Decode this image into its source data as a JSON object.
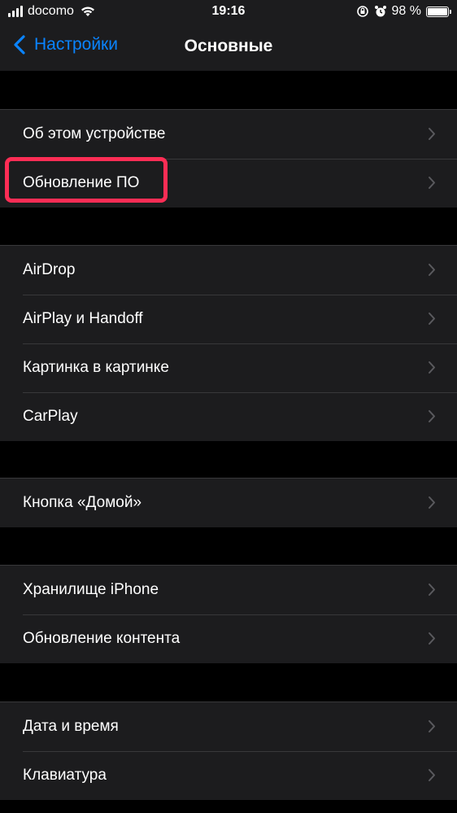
{
  "status": {
    "carrier": "docomo",
    "time": "19:16",
    "battery": "98 %",
    "battery_level": 0.98
  },
  "nav": {
    "back_label": "Настройки",
    "title": "Основные"
  },
  "groups": [
    [
      "Об этом устройстве",
      "Обновление ПО"
    ],
    [
      "AirDrop",
      "AirPlay и Handoff",
      "Картинка в картинке",
      "CarPlay"
    ],
    [
      "Кнопка «Домой»"
    ],
    [
      "Хранилище iPhone",
      "Обновление контента"
    ],
    [
      "Дата и время",
      "Клавиатура"
    ]
  ],
  "colors": {
    "accent": "#0a84ff",
    "highlight": "#ff2d55",
    "cell": "#1c1c1e"
  }
}
